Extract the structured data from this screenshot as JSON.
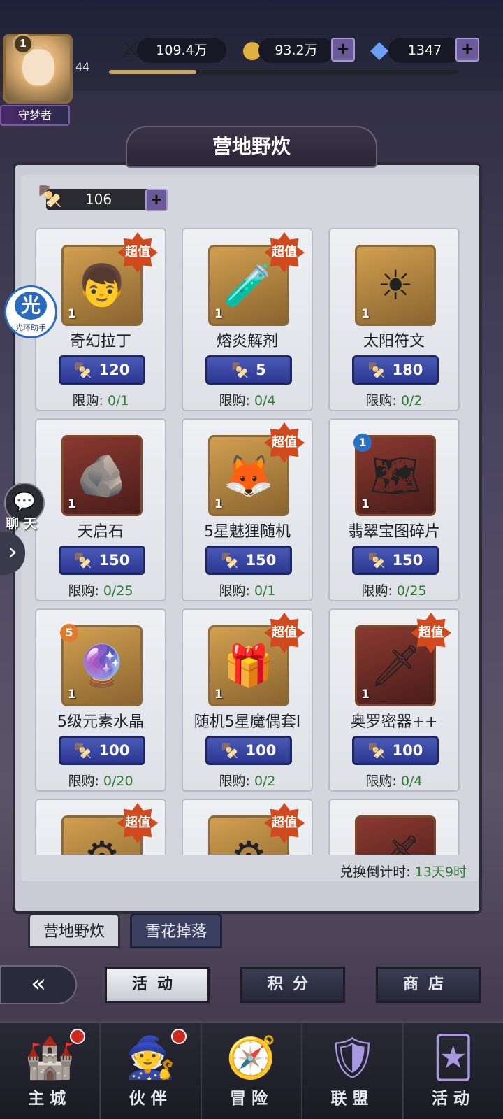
{
  "player": {
    "level_badge": "1",
    "title": "守梦者",
    "exp_level": "44",
    "exp_fraction": 0.25
  },
  "resources": {
    "power": "109.4万",
    "gold": "93.2万",
    "gems": "1347"
  },
  "page": {
    "title": "营地野炊",
    "currency_amount": "106",
    "countdown_label": "兑换倒计时: ",
    "countdown_value": "13天9时"
  },
  "items": [
    {
      "name": "奇幻拉丁",
      "qty": "1",
      "price": "120",
      "limit_label": "限购: ",
      "limit": "0/1",
      "super": "超值",
      "icon": "👦",
      "frame": "gold"
    },
    {
      "name": "熔炎解剂",
      "qty": "1",
      "price": "5",
      "limit_label": "限购: ",
      "limit": "0/4",
      "super": "超值",
      "icon": "🧪",
      "frame": "gold"
    },
    {
      "name": "太阳符文",
      "qty": "1",
      "price": "180",
      "limit_label": "限购: ",
      "limit": "0/2",
      "super": "",
      "icon": "☀",
      "frame": "gold"
    },
    {
      "name": "天启石",
      "qty": "1",
      "price": "150",
      "limit_label": "限购: ",
      "limit": "0/25",
      "super": "",
      "icon": "🪨",
      "frame": "red"
    },
    {
      "name": "5星魅狸随机",
      "qty": "1",
      "price": "150",
      "limit_label": "限购: ",
      "limit": "0/1",
      "super": "超值",
      "icon": "🦊",
      "frame": "gold"
    },
    {
      "name": "翡翠宝图碎片",
      "qty": "1",
      "price": "150",
      "limit_label": "限购: ",
      "limit": "0/25",
      "super": "",
      "icon": "🗺",
      "frame": "red",
      "corner": "1",
      "corner_color": "#2a72c8"
    },
    {
      "name": "5级元素水晶",
      "qty": "1",
      "price": "100",
      "limit_label": "限购: ",
      "limit": "0/20",
      "super": "",
      "icon": "🔮",
      "frame": "gold",
      "corner": "5",
      "corner_color": "#e07a2a"
    },
    {
      "name": "随机5星魔偶套I",
      "qty": "1",
      "price": "100",
      "limit_label": "限购: ",
      "limit": "0/2",
      "super": "超值",
      "icon": "🎁",
      "frame": "gold"
    },
    {
      "name": "奥罗密器++",
      "qty": "1",
      "price": "100",
      "limit_label": "限购: ",
      "limit": "0/4",
      "super": "超值",
      "icon": "🗡",
      "frame": "red"
    },
    {
      "name": "",
      "qty": "",
      "price": "",
      "limit_label": "",
      "limit": "",
      "super": "超值",
      "icon": "⚙",
      "frame": "gold"
    },
    {
      "name": "",
      "qty": "",
      "price": "",
      "limit_label": "",
      "limit": "",
      "super": "超值",
      "icon": "⚙",
      "frame": "gold"
    },
    {
      "name": "",
      "qty": "",
      "price": "",
      "limit_label": "",
      "limit": "",
      "super": "",
      "icon": "🗡",
      "frame": "red"
    }
  ],
  "tabs": {
    "active": "营地野炊",
    "inactive": "雪花掉落"
  },
  "actions": {
    "activity": "活动",
    "points": "积分",
    "shop": "商店"
  },
  "widgets": {
    "assist_big": "光",
    "assist_small": "光环助手",
    "chat_label": "聊 天"
  },
  "nav": [
    {
      "label": "主城",
      "icon": "🏰",
      "dot": true
    },
    {
      "label": "伙伴",
      "icon": "🧙",
      "dot": true
    },
    {
      "label": "冒险",
      "icon": "🧭",
      "dot": false
    },
    {
      "label": "联盟",
      "icon": "🛡",
      "dot": false
    },
    {
      "label": "活动",
      "icon": "🃏",
      "dot": false
    }
  ],
  "colors": {
    "accent_purple": "#6a5a9a",
    "price_blue": "#3a48a8",
    "limit_green": "#2e7a2e",
    "super_badge": "#d04a1e"
  }
}
